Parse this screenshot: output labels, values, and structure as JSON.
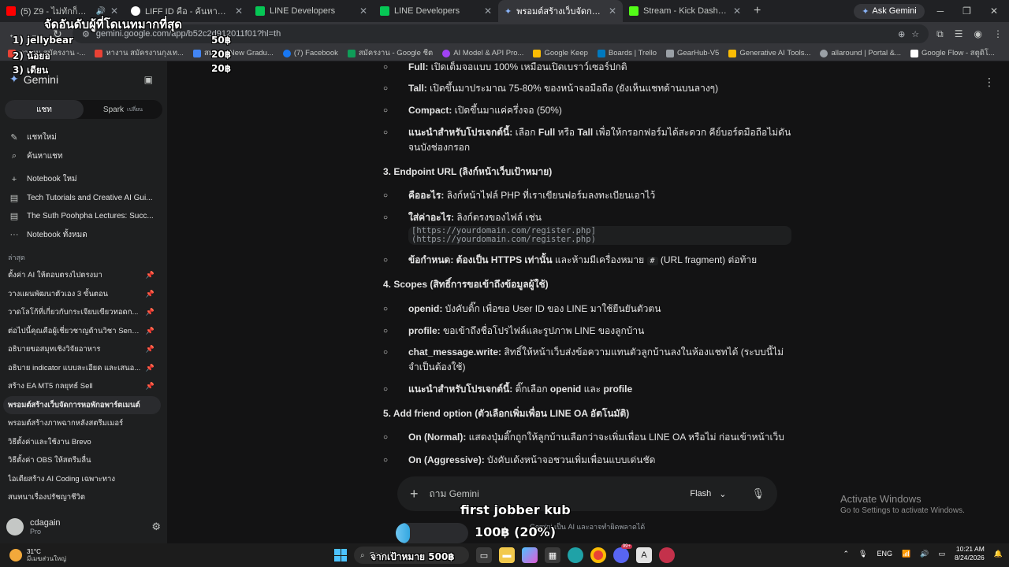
{
  "browser": {
    "tabs": [
      {
        "label": "(5) Z9 - ไม่ทักก็ว่า (Official M",
        "color": "#ff0000",
        "sound": true
      },
      {
        "label": "LIFF ID คือ - ค้นหาด้วย Google",
        "color": "#ffffff"
      },
      {
        "label": "LINE Developers",
        "color": "#06c755"
      },
      {
        "label": "LINE Developers",
        "color": "#06c755"
      },
      {
        "label": "พรอมต์สร้างเว็บจัดการหอพักอพาร์ตเ...",
        "color": "#8ab4f8",
        "active": true
      },
      {
        "label": "Stream - Kick Dashboard",
        "color": "#53fc18"
      }
    ],
    "new_tab": "+",
    "ask_gemini": "Ask Gemini",
    "url": "gemini.google.com/app/b52c2d912011f01?hl=th",
    "bookmarks": [
      {
        "label": "หางาน สมัครงาน -...",
        "color": "#e94235"
      },
      {
        "label": "หางาน สมัครงานกุงเท...",
        "color": "#e94235"
      },
      {
        "label": "สม...",
        "color": "#4285f4"
      },
      {
        "label": "New Gradu...",
        "color": "#8ab4f8"
      },
      {
        "label": "(7) Facebook",
        "color": "#1877f2"
      },
      {
        "label": "สมัครงาน - Google ชีต",
        "color": "#0f9d58"
      },
      {
        "label": "AI Model & API Pro...",
        "color": "#a142f4"
      },
      {
        "label": "Google Keep",
        "color": "#fbbc04"
      },
      {
        "label": "Boards | Trello",
        "color": "#0079bf"
      },
      {
        "label": "GearHub-V5",
        "color": "#9aa0a6"
      },
      {
        "label": "Generative AI Tools...",
        "color": "#fbbc04"
      },
      {
        "label": "allaround | Portal &...",
        "color": "#9aa0a6"
      },
      {
        "label": "Google Flow - สตูดิโ...",
        "color": "#ffffff"
      }
    ]
  },
  "overlay": {
    "title": "จัดอันดับผู้ที่โดเนทมากที่สุด",
    "ranks": [
      {
        "name": "1) jellybear",
        "amount": "50฿"
      },
      {
        "name": "2) น้อยอ",
        "amount": "20฿"
      },
      {
        "name": "3) เดียน",
        "amount": "20฿"
      }
    ],
    "goal_name": "first jobber kub",
    "goal_progress": "100฿ (20%)",
    "goal_fraction": 0.2,
    "goal_target": "จากเป้าหมาย 500฿"
  },
  "sidebar": {
    "app_name": "Gemini",
    "toggle": {
      "chat": "แชท",
      "spark": "Spark",
      "spark_badge": "เปลี่ยน"
    },
    "nav": [
      {
        "icon": "new-chat-icon",
        "label": "แชทใหม่"
      },
      {
        "icon": "search-icon",
        "label": "ค้นหาแชท"
      }
    ],
    "notebooks": [
      {
        "icon": "plus-icon",
        "label": "Notebook ใหม่"
      },
      {
        "icon": "notebook-icon",
        "label": "Tech Tutorials and Creative AI Gui..."
      },
      {
        "icon": "notebook-icon",
        "label": "The Suth Poohpha Lectures: Succ..."
      },
      {
        "icon": "more-icon",
        "label": "Notebook ทั้งหมด"
      }
    ],
    "recent_label": "ล่าสุด",
    "chats": [
      {
        "label": "ตั้งค่า AI ให้ตอบตรงไปตรงมา",
        "pinned": true
      },
      {
        "label": "วางแผนพัฒนาตัวเอง 3 ขั้นตอน",
        "pinned": true
      },
      {
        "label": "วาดโลโก้ที่เกี่ยวกับกระเจียบเขียวทอดก...",
        "pinned": true
      },
      {
        "label": "ต่อไปนี้คุณคือผู้เชี่ยวชาญด้านวิชา Sensor...",
        "pinned": true
      },
      {
        "label": "อธิบายขอสมุทเชิงวิจัยอาหาร",
        "pinned": true
      },
      {
        "label": "อธิบาย indicator แบบละเอียด และเสนอ...",
        "pinned": true
      },
      {
        "label": "สร้าง EA MT5 กลยุทธ์ Sell",
        "pinned": true
      },
      {
        "label": "พรอมต์สร้างเว็บจัดการหอพักอพาร์ตเมนต์",
        "active": true
      },
      {
        "label": "พรอมต์สร้างภาพฉากหลังสตรีมเมอร์"
      },
      {
        "label": "วิธีตั้งค่าและใช้งาน Brevo"
      },
      {
        "label": "วิธีตั้งค่า OBS ให้สตรีมลื่น"
      },
      {
        "label": "ไอเดียสร้าง AI Coding เฉพาะทาง"
      },
      {
        "label": "สนทนาเรื่องปรัชญาชีวิต"
      }
    ],
    "user": {
      "name": "cdagain",
      "plan": "Pro"
    }
  },
  "content": {
    "full": {
      "label": "Full:",
      "text": " เปิดเต็มจอแบบ 100% เหมือนเปิดเบราว์เซอร์ปกติ"
    },
    "tall": {
      "label": "Tall:",
      "text": " เปิดขึ้นมาประมาณ 75-80% ของหน้าจอมือถือ (ยังเห็นแชทด้านบนลางๆ)"
    },
    "compact": {
      "label": "Compact:",
      "text": " เปิดขึ้นมาแค่ครึ่งจอ (50%)"
    },
    "rec1": {
      "label": "แนะนำสำหรับโปรเจกต์นี้:",
      "text": " เลือก ",
      "b1": "Full",
      "mid": " หรือ ",
      "b2": "Tall",
      "tail": " เพื่อให้กรอกฟอร์มได้สะดวก คีย์บอร์ดมือถือไม่ดันจนบังช่องกรอก"
    },
    "sec3": "3. Endpoint URL (ลิงก์หน้าเว็บเป้าหมาย)",
    "what": {
      "label": "คืออะไร:",
      "text": " ลิงก์หน้าไฟล์ PHP ที่เราเขียนฟอร์มลงทะเบียนเอาไว้"
    },
    "put": {
      "label": "ใส่ค่าอะไร:",
      "text": " ลิงก์ตรงของไฟล์ เช่น"
    },
    "code1": "[https://yourdomain.com/register.php]",
    "code2": "(https://yourdomain.com/register.php)",
    "rule": {
      "label": "ข้อกำหนด: ต้องเป็น HTTPS เท่านั้น",
      "text": " และห้ามมีเครื่องหมาย ",
      "hash": "#",
      "tail": " (URL fragment) ต่อท้าย"
    },
    "sec4": "4. Scopes (สิทธิ์การขอเข้าถึงข้อมูลผู้ใช้)",
    "openid": {
      "label": "openid:",
      "text": " บังคับติ๊ก เพื่อขอ User ID ของ LINE มาใช้ยืนยันตัวตน"
    },
    "profile": {
      "label": "profile:",
      "text": " ขอเข้าถึงชื่อโปรไฟล์และรูปภาพ LINE ของลูกบ้าน"
    },
    "chat": {
      "label": "chat_message.write:",
      "text": " สิทธิ์ให้หน้าเว็บส่งข้อความแทนตัวลูกบ้านลงในห้องแชทได้ (ระบบนี้ไม่จำเป็นต้องใช้)"
    },
    "rec2": {
      "label": "แนะนำสำหรับโปรเจกต์นี้:",
      "text": " ติ๊กเลือก ",
      "b1": "openid",
      "mid": " และ ",
      "b2": "profile"
    },
    "sec5": "5. Add friend option (ตัวเลือกเพิ่มเพื่อน LINE OA อัตโนมัติ)",
    "on_normal": {
      "label": "On (Normal):",
      "text": " แสดงปุ่มติ๊กถูกให้ลูกบ้านเลือกว่าจะเพิ่มเพื่อน LINE OA หรือไม่ ก่อนเข้าหน้าเว็บ"
    },
    "on_aggr": {
      "label": "On (Aggressive):",
      "text": " บังคับเด้งหน้าจอชวนเพิ่มเพื่อนแบบเด่นชัด"
    }
  },
  "prompt": {
    "placeholder": "ถาม Gemini",
    "mode": "Flash",
    "disclaimer": "Gemini เป็น AI และอาจทำผิดพลาดได้"
  },
  "activate": {
    "line1": "Activate Windows",
    "line2": "Go to Settings to activate Windows."
  },
  "taskbar": {
    "temp": "31°C",
    "weather_desc": "มีเมฆส่วนใหญ่",
    "search": "Search",
    "lang": "ENG",
    "time": "10:21 AM",
    "date": "8/24/2026",
    "discord_badge": "99+"
  }
}
